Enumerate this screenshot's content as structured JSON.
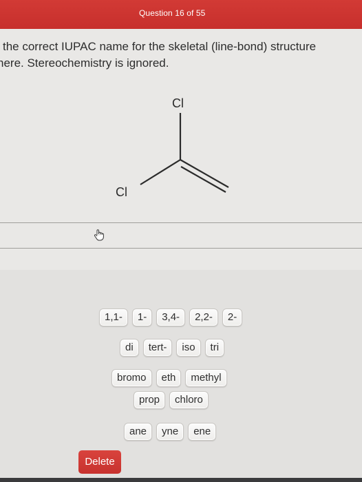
{
  "header": {
    "title": "Question 16 of 55",
    "color": "#c93331"
  },
  "prompt": {
    "line1": "the correct IUPAC name for the skeletal (line-bond) structure",
    "line2": "here. Stereochemistry is ignored."
  },
  "molecule": {
    "atom_top": "Cl",
    "atom_left": "Cl"
  },
  "tiles": {
    "row1": [
      "1,1-",
      "1-",
      "3,4-",
      "2,2-",
      "2-"
    ],
    "row2": [
      "di",
      "tert-",
      "iso",
      "tri"
    ],
    "row3": [
      "bromo",
      "eth",
      "methyl"
    ],
    "row4": [
      "prop",
      "chloro"
    ],
    "row5": [
      "ane",
      "yne",
      "ene"
    ]
  },
  "delete_label": "Delete",
  "colors": {
    "accent": "#c93331",
    "background": "#e9e8e6"
  }
}
